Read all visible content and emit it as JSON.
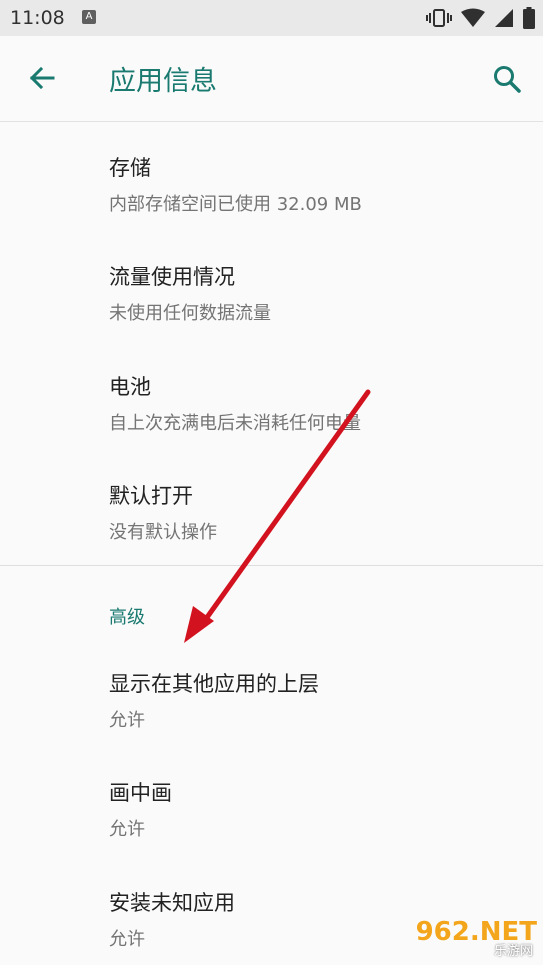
{
  "status_bar": {
    "time": "11:08",
    "notification_icon": "A",
    "icons": [
      "vibrate-icon",
      "wifi-icon",
      "signal-icon",
      "battery-icon"
    ]
  },
  "app_bar": {
    "title": "应用信息",
    "back_icon": "arrow-left-icon",
    "search_icon": "search-icon"
  },
  "items": [
    {
      "title": "存储",
      "subtitle": "内部存储空间已使用 32.09 MB"
    },
    {
      "title": "流量使用情况",
      "subtitle": "未使用任何数据流量"
    },
    {
      "title": "电池",
      "subtitle": "自上次充满电后未消耗任何电量"
    },
    {
      "title": "默认打开",
      "subtitle": "没有默认操作"
    }
  ],
  "advanced": {
    "section_title": "高级",
    "items": [
      {
        "title": "显示在其他应用的上层",
        "subtitle": "允许"
      },
      {
        "title": "画中画",
        "subtitle": "允许"
      },
      {
        "title": "安装未知应用",
        "subtitle": "允许"
      }
    ]
  },
  "watermark": {
    "logo": "962.NET",
    "text": "乐游网"
  },
  "colors": {
    "accent": "#1a7a70",
    "annotation_arrow": "#d3121f"
  }
}
